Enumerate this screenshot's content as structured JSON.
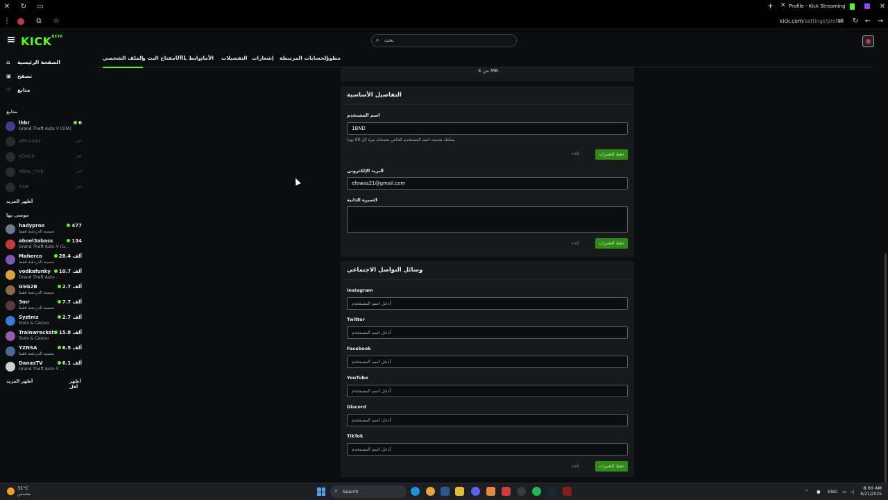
{
  "browser": {
    "tab_title": "Profile - Kick Streaming",
    "url_host": "kick.com",
    "url_path": "/settings/profile"
  },
  "header": {
    "logo": "KICK",
    "logo_sup": "BETA",
    "search_placeholder": "بحث"
  },
  "tabs": [
    {
      "label": "الملف الشخصي",
      "active": true
    },
    {
      "label": "مفتاح البث وURL رابط"
    },
    {
      "label": "الأمان"
    },
    {
      "label": "التفضيلات"
    },
    {
      "label": "إشعارات"
    },
    {
      "label": "الحسابات المرتبطة"
    },
    {
      "label": "مطور"
    }
  ],
  "sidebar": {
    "nav": [
      {
        "label": "الصفحة الرئيسية",
        "icon": "home-icon"
      },
      {
        "label": "تصفح",
        "icon": "browse-icon"
      },
      {
        "label": "متابع",
        "icon": "heart-icon"
      }
    ],
    "following_title": "متابع",
    "following": [
      {
        "name": "lhbr",
        "category": "Grand Theft Auto V (GTA)",
        "viewers": "6",
        "live": true,
        "color": "#3b3f8f"
      },
      {
        "name": "xMusaad",
        "status": "غير",
        "live": false
      },
      {
        "name": "sDwLh",
        "status": "غير",
        "live": false
      },
      {
        "name": "Aboo_7rrb",
        "status": "غير",
        "live": false
      },
      {
        "name": "SXB",
        "status": "غير",
        "live": false
      }
    ],
    "show_more_following": "أظهر المزيد",
    "recommended_title": "موصى بها",
    "recommended": [
      {
        "name": "hadyproo",
        "category": "منصبة الدردشة فقط",
        "viewers": "477",
        "color": "#6a7a8c"
      },
      {
        "name": "aboel3abass",
        "category": "Grand Theft Auto V (G...",
        "viewers": "134",
        "color": "#c23b3b"
      },
      {
        "name": "Maherco",
        "category": "منصبة الدردشة فقط",
        "viewers": "28.4 ألف",
        "color": "#7a5ab0"
      },
      {
        "name": "vodkafunky",
        "category": "Grand Theft Auto ...",
        "viewers": "10.7 ألف",
        "color": "#d9a23a"
      },
      {
        "name": "GSG2B",
        "category": "منصبة الدردشة فقط",
        "viewers": "2.7 ألف",
        "color": "#8a6a4a"
      },
      {
        "name": "3mr",
        "category": "منصبة الدردشة فقط",
        "viewers": "7.7 ألف",
        "color": "#5a3a3a"
      },
      {
        "name": "Syztmz",
        "category": "Slots & Casino",
        "viewers": "2.7 ألف",
        "color": "#3a7ad9"
      },
      {
        "name": "Trainwreckstv",
        "category": "Slots & Casino",
        "viewers": "15.8 ألف",
        "color": "#9a5ab0"
      },
      {
        "name": "YZNSA",
        "category": "منصبة الدردشة فقط",
        "viewers": "6.5 ألف",
        "color": "#4a6a9a"
      },
      {
        "name": "DanasTV",
        "category": "Grand Theft Auto V ...",
        "viewers": "6.1 ألف",
        "color": "#cfcfcf"
      }
    ],
    "show_more": "أظهر المزيد",
    "show_less": "أظهر أقل"
  },
  "profile": {
    "upload_hint": "من 4 MB.",
    "basic_title": "التفاصيل الأساسية",
    "username_label": "اسم المستخدم",
    "username_value": "1BND",
    "username_hint": "يمكنك تحديث اسم المستخدم الخاص بحسابك مرة كل 60 يوما.",
    "email_label": "البريد الإلكتروني",
    "email_value": "efowsa21@gmail.com",
    "bio_label": "السيرة الذاتية",
    "save_label": "حفظ التغييرات",
    "cancel_label": "إلغاء"
  },
  "social": {
    "title": "وسائل التواصل الاجتماعي",
    "placeholder": "أدخل اسم المستخدم",
    "fields": [
      "Instagram",
      "Twitter",
      "Facebook",
      "YouTube",
      "Discord",
      "TikTok"
    ]
  },
  "taskbar": {
    "weather_temp": "31°C",
    "weather_desc": "مشمس",
    "search_label": "Search",
    "lang": "ENG",
    "time": "8:00 AM",
    "date": "8/21/2025"
  }
}
